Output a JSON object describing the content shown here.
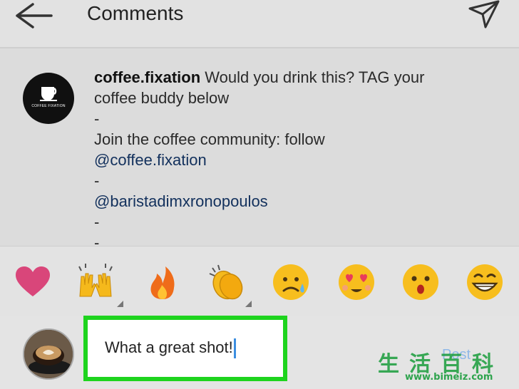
{
  "header": {
    "title": "Comments",
    "back_icon": "arrow-left-icon",
    "send_icon": "paper-plane-icon"
  },
  "caption": {
    "username": "coffee.fixation",
    "avatar_text": "COFFEE FIXATION",
    "line1": " Would you drink this? TAG your",
    "line2": "coffee buddy below",
    "line3": "-",
    "line4": "Join the coffee community: follow",
    "mention1": "@coffee.fixation",
    "line6": "-",
    "mention2": "@baristadimxronopoulos",
    "line8": "-",
    "line9": "-"
  },
  "emoji_bar": {
    "items": [
      "heart-emoji",
      "raising-hands-emoji",
      "fire-emoji",
      "clapping-hands-emoji",
      "sad-tear-emoji",
      "heart-eyes-emoji",
      "surprised-emoji",
      "grinning-emoji"
    ]
  },
  "composer": {
    "input_value": "What a great shot!",
    "post_label": "Post"
  },
  "watermark": {
    "chars": "生活百科",
    "url": "www.bimeiz.com"
  },
  "colors": {
    "highlight": "#1ed41e",
    "cursor": "#3c8ee0",
    "mention": "#12305c"
  }
}
